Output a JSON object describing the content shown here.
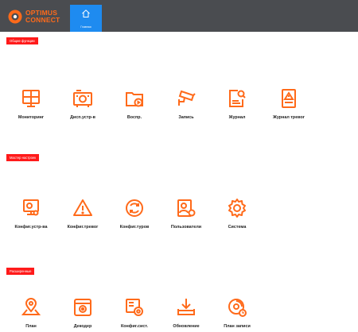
{
  "app": {
    "logo_line1": "OPTIMUS",
    "logo_line2": "CONNECT",
    "home_tab_label": "Главная"
  },
  "colors": {
    "topbar": "#4a4c50",
    "accent": "#ff6a1a",
    "home_tab": "#1e8bf0",
    "section_tag": "#ff1a1a"
  },
  "sections": [
    {
      "title": "Общие функции",
      "items": [
        {
          "label": "Мониторинг",
          "icon": "monitor-split-icon"
        },
        {
          "label": "Дисп.устр-в",
          "icon": "device-manager-icon"
        },
        {
          "label": "Воспр.",
          "icon": "playback-folder-icon"
        },
        {
          "label": "Запись",
          "icon": "camera-record-icon"
        },
        {
          "label": "Журнал",
          "icon": "log-search-icon"
        },
        {
          "label": "Журнал тревог",
          "icon": "alarm-log-icon"
        }
      ]
    },
    {
      "title": "Мастер настроек",
      "items": [
        {
          "label": "Конфиг.устр-ва",
          "icon": "device-config-icon"
        },
        {
          "label": "Конфиг.тревог",
          "icon": "alarm-warning-icon"
        },
        {
          "label": "Конфиг.туров",
          "icon": "tour-cycle-icon"
        },
        {
          "label": "Пользователи",
          "icon": "user-settings-icon"
        },
        {
          "label": "Система",
          "icon": "gear-icon"
        }
      ]
    },
    {
      "title": "Расширенные",
      "items": [
        {
          "label": "План",
          "icon": "map-pin-icon"
        },
        {
          "label": "Декодер",
          "icon": "decoder-icon"
        },
        {
          "label": "Конфиг.сист.",
          "icon": "system-config-icon"
        },
        {
          "label": "Обновление",
          "icon": "download-update-icon"
        },
        {
          "label": "План записи",
          "icon": "record-schedule-icon"
        }
      ]
    }
  ]
}
